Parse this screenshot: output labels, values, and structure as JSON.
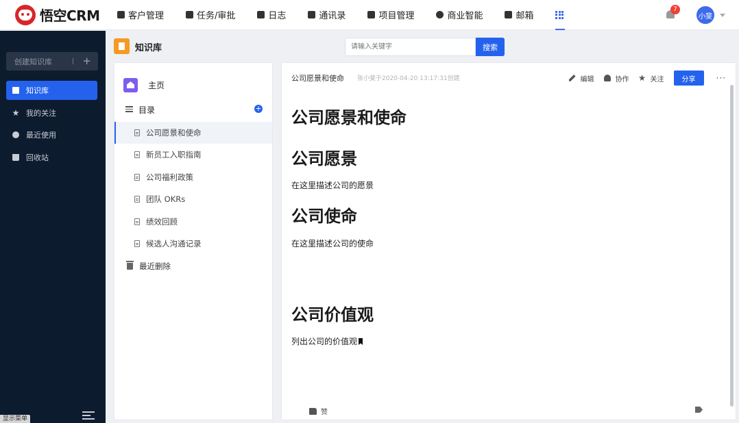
{
  "app": {
    "logo_text": "悟空CRM"
  },
  "nav": {
    "items": [
      {
        "label": "客户管理",
        "icon": "building-icon"
      },
      {
        "label": "任务/审批",
        "icon": "briefcase-icon"
      },
      {
        "label": "日志",
        "icon": "log-icon"
      },
      {
        "label": "通讯录",
        "icon": "contacts-icon"
      },
      {
        "label": "项目管理",
        "icon": "project-icon"
      },
      {
        "label": "商业智能",
        "icon": "shield-check-icon"
      },
      {
        "label": "邮箱",
        "icon": "mail-icon"
      }
    ],
    "apps_icon": "grid-icon"
  },
  "user": {
    "notification_count": "7",
    "avatar_label": "小斐"
  },
  "sidebar": {
    "create_label": "创建知识库",
    "items": [
      {
        "label": "知识库",
        "icon": "book-icon",
        "active": true
      },
      {
        "label": "我的关注",
        "icon": "star-icon",
        "active": false
      },
      {
        "label": "最近使用",
        "icon": "clock-icon",
        "active": false
      },
      {
        "label": "回收站",
        "icon": "trash-icon",
        "active": false
      }
    ],
    "show_menu_label": "显示菜单"
  },
  "header": {
    "title": "知识库",
    "search_placeholder": "请输入关键字",
    "search_button": "搜索"
  },
  "tree": {
    "home_label": "主页",
    "toc_label": "目录",
    "docs": [
      {
        "label": "公司愿景和使命",
        "active": true
      },
      {
        "label": "新员工入职指南",
        "active": false
      },
      {
        "label": "公司福利政策",
        "active": false
      },
      {
        "label": "团队 OKRs",
        "active": false
      },
      {
        "label": "绩效回顾",
        "active": false
      },
      {
        "label": "候选人沟通记录",
        "active": false
      }
    ],
    "trash_label": "最近删除"
  },
  "doc": {
    "title": "公司愿景和使命",
    "meta": "张小斐于2020-04-20 13:17:31创建",
    "actions": {
      "edit": "编辑",
      "collaborate": "协作",
      "follow": "关注",
      "share": "分享",
      "more": "···"
    },
    "blocks": {
      "h_main": "公司愿景和使命",
      "h_vision": "公司愿景",
      "p_vision": "在这里描述公司的愿景",
      "h_mission": "公司使命",
      "p_mission": "在这里描述公司的使命",
      "h_values": "公司价值观",
      "p_values": "列出公司的价值观"
    },
    "like_label": "赞"
  },
  "colors": {
    "primary": "#2462ee",
    "sidebar_bg": "#0d1b2e",
    "kb_icon": "#f59a23",
    "home_icon": "#7d5cf0",
    "badge": "#f04134"
  }
}
